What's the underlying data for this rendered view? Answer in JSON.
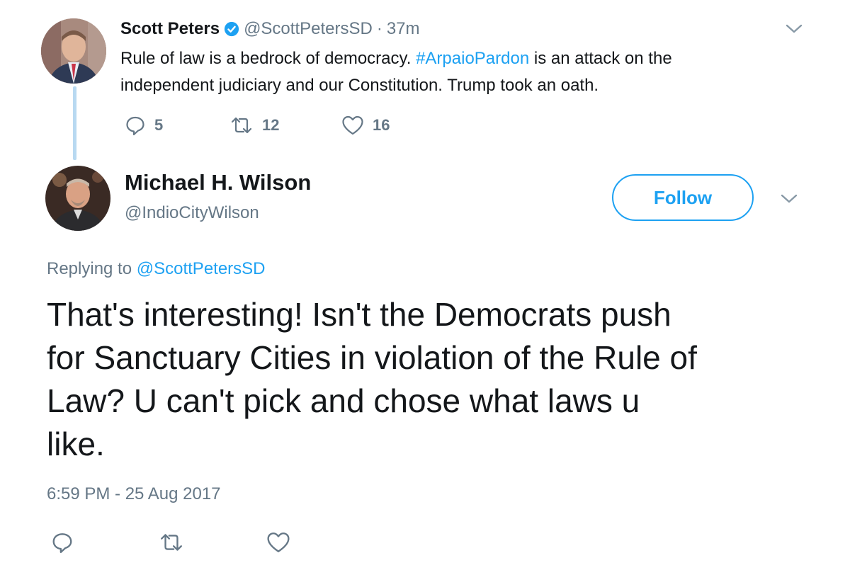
{
  "parent_tweet": {
    "name": "Scott Peters",
    "handle": "@ScottPetersSD",
    "separator": "·",
    "time": "37m",
    "text_before": "Rule of law is a bedrock of democracy. ",
    "hashtag": "#ArpaioPardon",
    "text_after": " is an attack on the",
    "text_line2": "independent judiciary and our Constitution. Trump took an oath.",
    "reply_count": "5",
    "retweet_count": "12",
    "like_count": "16"
  },
  "reply_tweet": {
    "name": "Michael H. Wilson",
    "handle": "@IndioCityWilson",
    "follow_label": "Follow",
    "replying_to_label": "Replying to",
    "replying_to_handle": "@ScottPetersSD",
    "text": [
      "That's interesting! Isn't the Democrats push",
      "for Sanctuary Cities in violation of the Rule of",
      "Law? U can't pick and chose what laws u",
      "like."
    ],
    "timestamp": "6:59 PM - 25 Aug 2017"
  },
  "colors": {
    "accent": "#1da1f2",
    "muted": "#657786",
    "text": "#14171a",
    "thread_line": "#b8d9f1"
  },
  "icons": [
    "verified-badge-icon",
    "chevron-down-icon",
    "reply-icon",
    "retweet-icon",
    "like-icon"
  ]
}
